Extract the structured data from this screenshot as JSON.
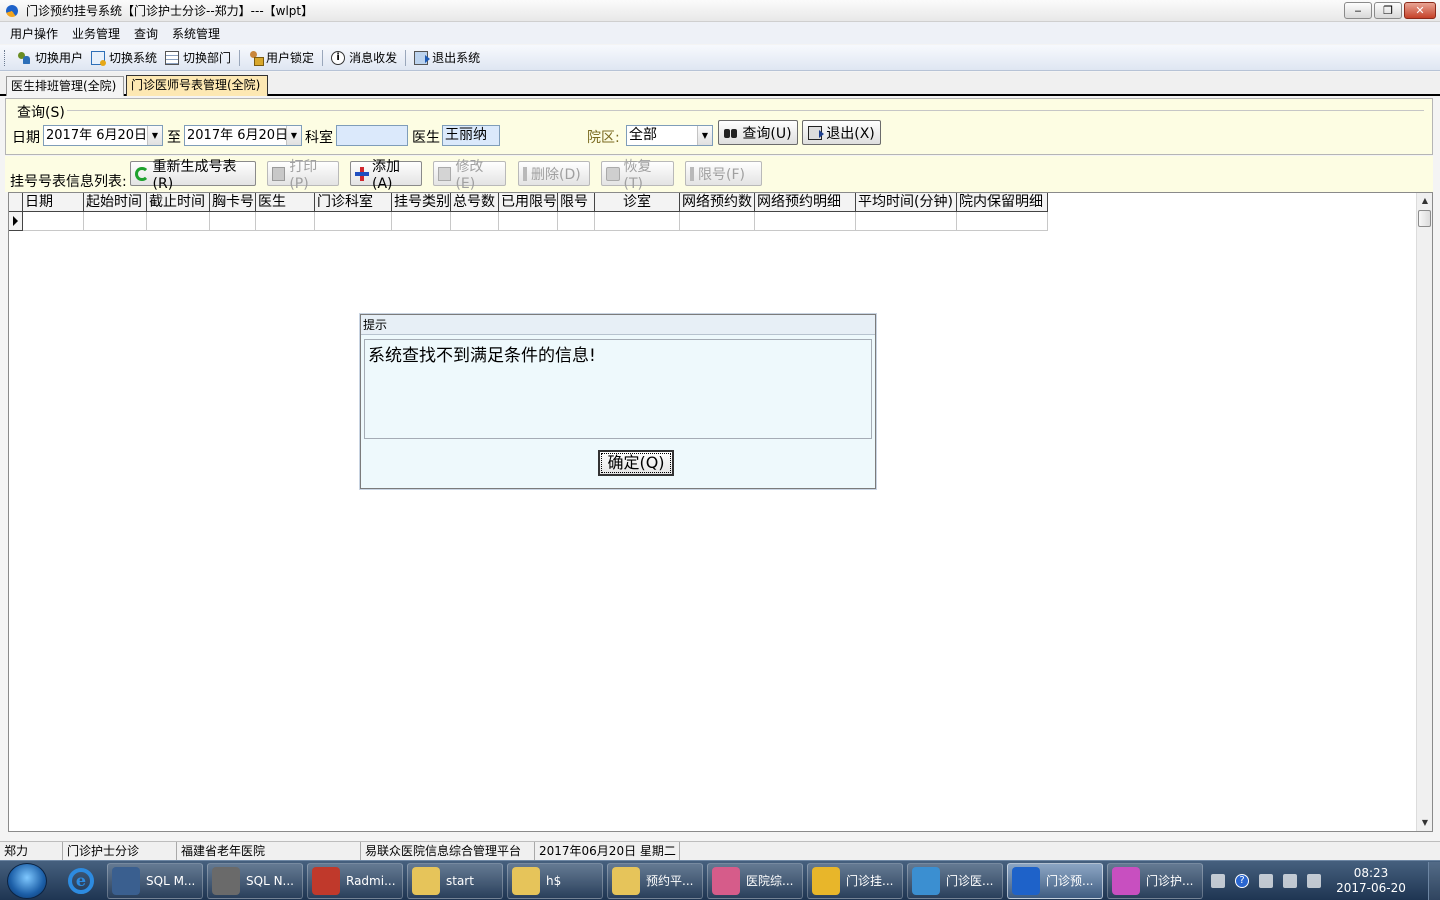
{
  "window": {
    "title": "门诊预约挂号系统【门诊护士分诊--郑力】---【wlpt】",
    "minimize": "‒",
    "restore": "❐",
    "close": "✕"
  },
  "menu": [
    "用户操作",
    "业务管理",
    "查询",
    "系统管理"
  ],
  "toolbar": {
    "switch_user": "切换用户",
    "switch_system": "切换系统",
    "switch_dept": "切换部门",
    "lock_user": "用户锁定",
    "messages": "消息收发",
    "exit": "退出系统"
  },
  "tabs": [
    {
      "label": "医生排班管理(全院)",
      "active": false
    },
    {
      "label": "门诊医师号表管理(全院)",
      "active": true
    }
  ],
  "query": {
    "legend": "查询(S)",
    "date_label": "日期",
    "date_from": "2017年 6月20日",
    "to_label": "至",
    "date_to": "2017年 6月20日",
    "dept_label": "科室",
    "dept_value": "",
    "doctor_label": "医生",
    "doctor_value": "王丽纳",
    "campus_label": "院区:",
    "campus_value": "全部",
    "search_button": "查询(U)",
    "exit_button": "退出(X)",
    "dropdown_arrow": "▼"
  },
  "actions": {
    "label": "挂号号表信息列表:",
    "regenerate": "重新生成号表(R)",
    "print": "打印(P)",
    "add": "添加(A)",
    "edit": "修改(E)",
    "delete": "删除(D)",
    "restore": "恢复(T)",
    "limit": "限号(F)"
  },
  "grid": {
    "columns": [
      "日期",
      "起始时间",
      "截止时间",
      "胸卡号",
      "医生",
      "门诊科室",
      "挂号类别",
      "总号数",
      "已用限号",
      "限号",
      "诊室",
      "网络预约数",
      "网络预约明细",
      "平均时间(分钟)",
      "院内保留明细"
    ],
    "scroll_up": "▲",
    "scroll_down": "▼"
  },
  "dialog": {
    "title": "提示",
    "message": "系统查找不到满足条件的信息!",
    "ok_button": "确定(Q)"
  },
  "statusbar": [
    "郑力",
    "门诊护士分诊",
    "福建省老年医院",
    "易联众医院信息综合管理平台",
    "2017年06月20日 星期二",
    ""
  ],
  "taskbar": {
    "ie_glyph": "e",
    "tasks": [
      {
        "label": "SQL M...",
        "color": "#3a5f8f",
        "active": false
      },
      {
        "label": "SQL N...",
        "color": "#6a6a6a",
        "active": false
      },
      {
        "label": "Radmi...",
        "color": "#c0392b",
        "active": false
      },
      {
        "label": "start",
        "color": "#e6c45a",
        "active": false
      },
      {
        "label": "h$",
        "color": "#e6c45a",
        "active": false
      },
      {
        "label": "预约平...",
        "color": "#e6c45a",
        "active": false
      },
      {
        "label": "医院综...",
        "color": "#d65c8a",
        "active": false
      },
      {
        "label": "门诊挂...",
        "color": "#e8b62a",
        "active": false
      },
      {
        "label": "门诊医...",
        "color": "#3b8fd1",
        "active": false
      },
      {
        "label": "门诊预...",
        "color": "#1e62c9",
        "active": true
      },
      {
        "label": "门诊护...",
        "color": "#c84fc0",
        "active": false
      }
    ],
    "help_glyph": "?",
    "time": "08:23",
    "date": "2017-06-20"
  }
}
